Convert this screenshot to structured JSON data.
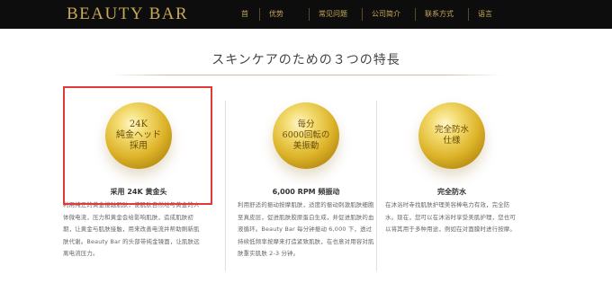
{
  "header": {
    "logo": "BEAUTY BAR",
    "nav": [
      "首",
      "优势",
      "常见问题",
      "公司简介",
      "联系方式",
      "语言"
    ]
  },
  "headline": "スキンケアのための３つの特長",
  "features": [
    {
      "medal": "24K\n純金ヘッド\n採用",
      "caption": "采用 24K 黄金头",
      "description": "利用纯正的黄金接触肌肤，使肌肤自然地与黄金的人体微电流，压力和黄金会给影响肌肤，造成肌肤初期，让黄金与肌肤接触，用来改善电流并帮助刷新肌肤代谢。Beauty Bar 的头部带纯金镜面，让肌肤远离电流压力。"
    },
    {
      "medal": "毎分\n6000回転の\n美振動",
      "caption": "6,000 RPM 频振动",
      "description": "利用舒适的振动按摩肌肤，适度的振动刺激肌肤细胞至真皮层，促进肌肤胶原蛋白生成，并促进肌肤的血液循环。Beauty Bar 每分钟振动 6,000 下，透过持续低频率按摩来打造紧致肌肤，在也意对用容对肌肤重实肌肤 2-3 分钟。"
    },
    {
      "medal": "完全防水\n仕様",
      "caption": "完全防水",
      "description": "在沐浴时寺找肌肤护理美容棒电力有效，完全防水。现在，您可以在沐浴时享受美肌护理，您也可以将其用于多种用途，例如在对面膜时进行按摩。"
    }
  ]
}
